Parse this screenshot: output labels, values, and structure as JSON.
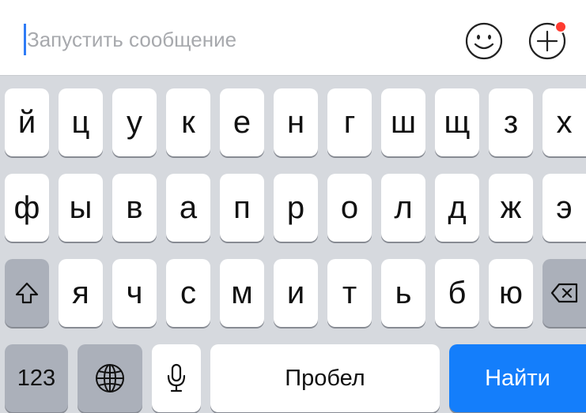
{
  "compose": {
    "placeholder": "Запустить сообщение",
    "value": ""
  },
  "toolbar": {
    "emoji_icon": "smiley-icon",
    "attach_icon": "plus-circle-icon",
    "attach_badge_color": "#ff3b30"
  },
  "keyboard": {
    "row1": [
      "й",
      "ц",
      "у",
      "к",
      "е",
      "н",
      "г",
      "ш",
      "щ",
      "з",
      "х"
    ],
    "row2": [
      "ф",
      "ы",
      "в",
      "а",
      "п",
      "р",
      "о",
      "л",
      "д",
      "ж",
      "э"
    ],
    "row3": [
      "я",
      "ч",
      "с",
      "м",
      "и",
      "т",
      "ь",
      "б",
      "ю"
    ],
    "shift_icon": "shift-icon",
    "backspace_icon": "backspace-icon",
    "numbers_label": "123",
    "globe_icon": "globe-icon",
    "mic_icon": "microphone-icon",
    "space_label": "Пробел",
    "action_label": "Найти",
    "action_color": "#147efb"
  }
}
